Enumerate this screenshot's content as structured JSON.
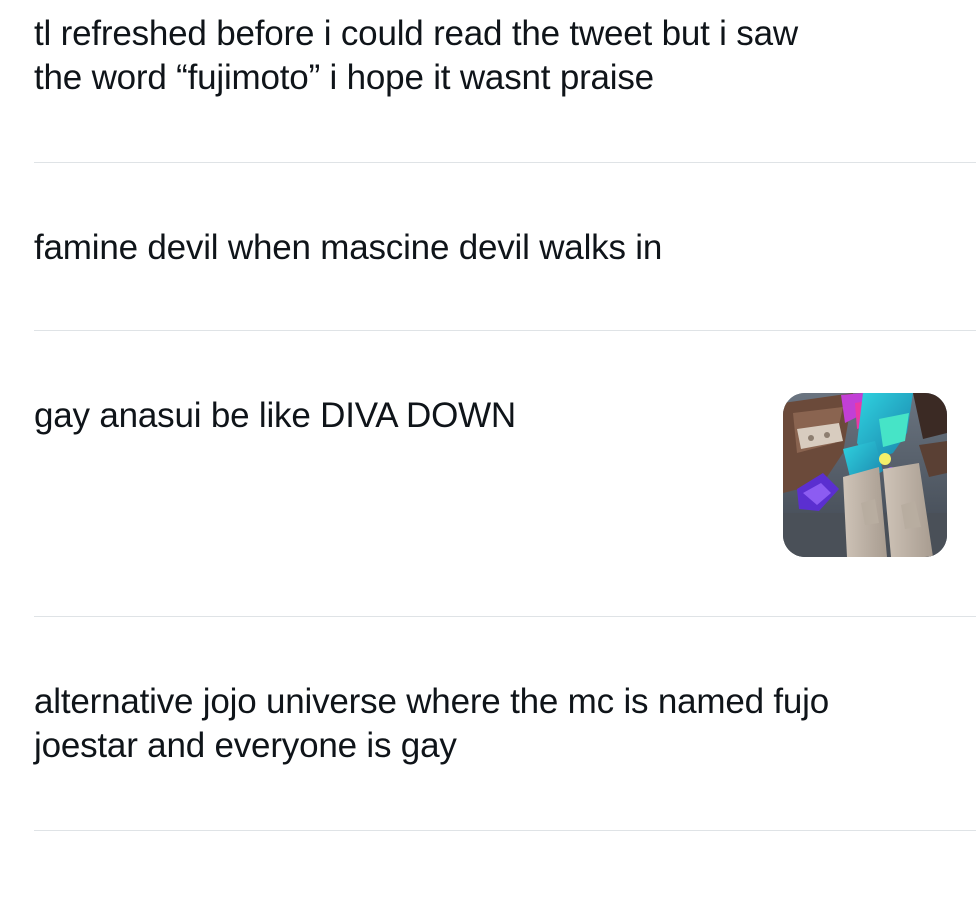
{
  "tweets": [
    {
      "text": "tl refreshed before i could read the tweet but i saw\nthe word “fujimoto” i hope it wasnt praise"
    },
    {
      "text": "famine devil when mascine devil walks in"
    },
    {
      "text": "gay anasui be like DIVA DOWN",
      "thumbnail_icon": "anime-character-image"
    },
    {
      "text": "alternative jojo universe where the mc is named fujo\njoestar and everyone is gay"
    }
  ],
  "colors": {
    "text": "#0f1419",
    "divider": "#dfe3e6",
    "background": "#ffffff"
  }
}
